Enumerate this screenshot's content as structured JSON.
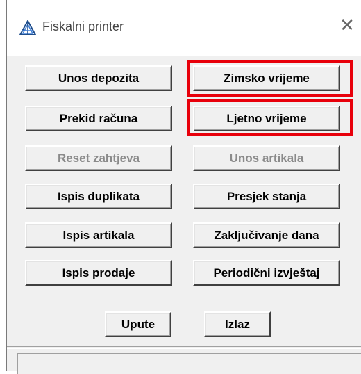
{
  "window": {
    "title": "Fiskalni printer",
    "close_glyph": "✕"
  },
  "buttons": {
    "unos_depozita": "Unos depozita",
    "zimsko_vrijeme": "Zimsko vrijeme",
    "prekid_racuna": "Prekid računa",
    "ljetno_vrijeme": "Ljetno vrijeme",
    "reset_zahtjeva": "Reset zahtjeva",
    "unos_artikala": "Unos artikala",
    "ispis_duplikata": "Ispis duplikata",
    "presjek_stanja": "Presjek stanja",
    "ispis_artikala": "Ispis artikala",
    "zakljucivanje_dana": "Zaključivanje dana",
    "ispis_prodaje": "Ispis prodaje",
    "periodicni_izvjestaj": "Periodični izvještaj",
    "upute": "Upute",
    "izlaz": "Izlaz"
  },
  "colors": {
    "highlight": "#e8000b",
    "window_bg": "#f0f0f0",
    "disabled_text": "#8a8a8a"
  },
  "icons": {
    "app": "printer-logo-icon",
    "close": "close-icon"
  }
}
